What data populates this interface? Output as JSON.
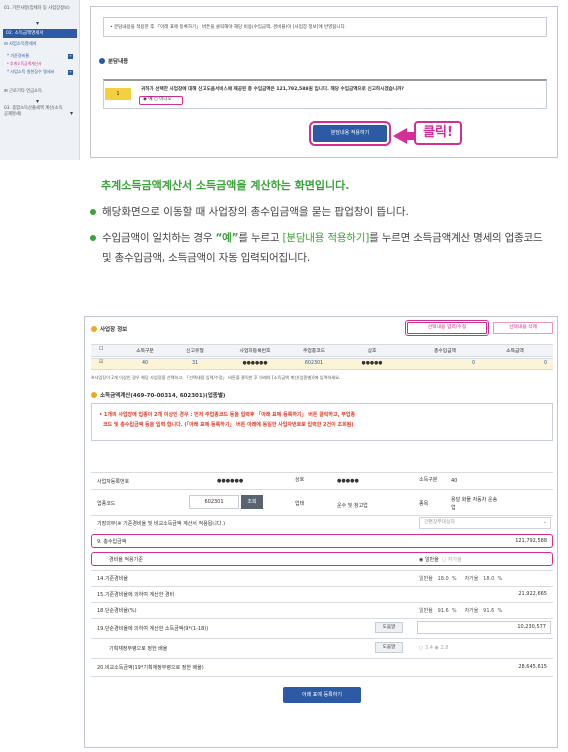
{
  "sidebar": {
    "item1": "01. 기본사항(업체자 등 사업장정보)",
    "active": "02. 소득금액명세서",
    "expand_label": "사업소득명세서",
    "sub1": "기준경비율",
    "sub2": "추계소득금액계산서",
    "sub3": "사업소득 원천징수 명세서",
    "item_labor": "근로기타 연금소득",
    "item3": "03. 종합소득산출세액 계산(소득공제명세)",
    "badge1": "+",
    "badge2": "+"
  },
  "top": {
    "notice": "• 분담내용을 적용한 후 「아래 표에 등록하기」 버튼을 클릭해야 해당 비용(수입금액, 경비율)이 [사업장 정보]에 반영됩니다.",
    "section_title": "분담내용",
    "q_num": "1",
    "q_text": "귀하가 선택한 사업장에 대해 신고도움서비스에 제공된 총 수입금액은 121,792,588원 입니다. 해당 수입금액으로 신고하시겠습니까?",
    "radio_yes": "예",
    "radio_no": "아니오",
    "apply_button": "분담내용 적용하기",
    "click_label": "클릭!"
  },
  "caption": "추계소득금액계산서 소득금액을 계산하는 화면입니다.",
  "bullets": [
    "해당화면으로 이동할 때 사업장의 총수입금액을 묻는 팝업창이 뜹니다.",
    "수입금액이 일치하는 경우 “예”를 누르고 [분담내용 적용하기]를 누르면 소득금액계산 명세의 업종코드 및 총수입금액, 소득금액이 자동 입력되어집니다."
  ],
  "bullet2_parts": {
    "a": "수입금액이 일치하는 경우 ",
    "yes": "“예”",
    "b": "를 누르고 ",
    "apply": "[분담내용 적용하기]",
    "c": "를 누르면 소득금액계산 명세의 업종코드 및 총수입금액, 소득금액이 자동 입력되어집니다."
  },
  "biz": {
    "title": "사업장 정보",
    "btn_input": "선택내용 입력/수정",
    "btn_delete": "선택내용 삭제",
    "headers": [
      "소득구분",
      "신고유형",
      "사업자등록번호",
      "주업종코드",
      "상호",
      "총수입금액",
      "소득금액"
    ],
    "row": [
      "40",
      "31",
      "●●●●●●",
      "602301",
      "●●●●●",
      "0",
      "0"
    ],
    "footnote": "※사업장이 2개 이상인 경우 해당 사업장을 선택하고, 「선택내용 입력/수정」 버튼을 클릭한 후 아래의 [소득금액 계산(업종별)]에 입력하세요."
  },
  "calc": {
    "title": "소득금액계산(469-70-00314, 602301)(업종별)",
    "warn1": "• 1개의 사업장에 업종이 2개 이상인 경우 : 먼저 주업종코드 등을 입력후 「아래 표에 등록하기」 버튼 클릭하고, 부업종",
    "warn2": "코드 및 총수입금액 등을 입력 합니다. (「아래 표에 등록하기」 버튼 아래에 동일한 사업자번호로 입력한 2건이 조회됨)",
    "reg_label": "사업자등록번호",
    "reg_value": "●●●●●●",
    "name_label": "상호",
    "name_value": "●●●●●",
    "type_label": "소득구분",
    "type_value": "40",
    "code_label": "업종코드",
    "code_value": "602301",
    "lookup_btn": "조회",
    "biz_label": "업태",
    "biz_value": "운수 및 창고업",
    "item_label": "종목",
    "item_value": "용달 화물 자동차 운송업",
    "duty_label": "기장의무(※ 기준경비율 및 비교소득금액 계산서 적용됩니다.)",
    "duty_value": "간편장부대상자",
    "r9_label": "9. 총수입금액",
    "r9_value": "121,792,588",
    "rate_label": "경비율 적용기준",
    "rate_opt1": "일반율",
    "rate_opt2": "자가율",
    "r14_label": "14.기준경비율",
    "r14_value": "일반율   18.0  %     자가율   18.0  %",
    "r15_label": "15.기준경비율에 의하여 계산한 경비",
    "r15_value": "21,922,665",
    "r18_label": "18.단순경비율(%)",
    "r18_value": "일반율   91.6  %     자가율   91.6  %",
    "r19_label": "19.단순경비율에 의하여 계산한 소득금액(9*(1-18))",
    "r19_btn": "도움말",
    "r19_value": "10,230,577",
    "r_fin_label": "기획재정부령으로 정한 배율",
    "r_fin_btn": "도움말",
    "r_fin_opt1": "3.4",
    "r_fin_opt2": "2.8",
    "r20_label": "20.비교소득금액(19*기획재정부령으로 정한 배율)",
    "r20_value": "28,645,615",
    "register_btn": "아래 표에 등록하기"
  }
}
